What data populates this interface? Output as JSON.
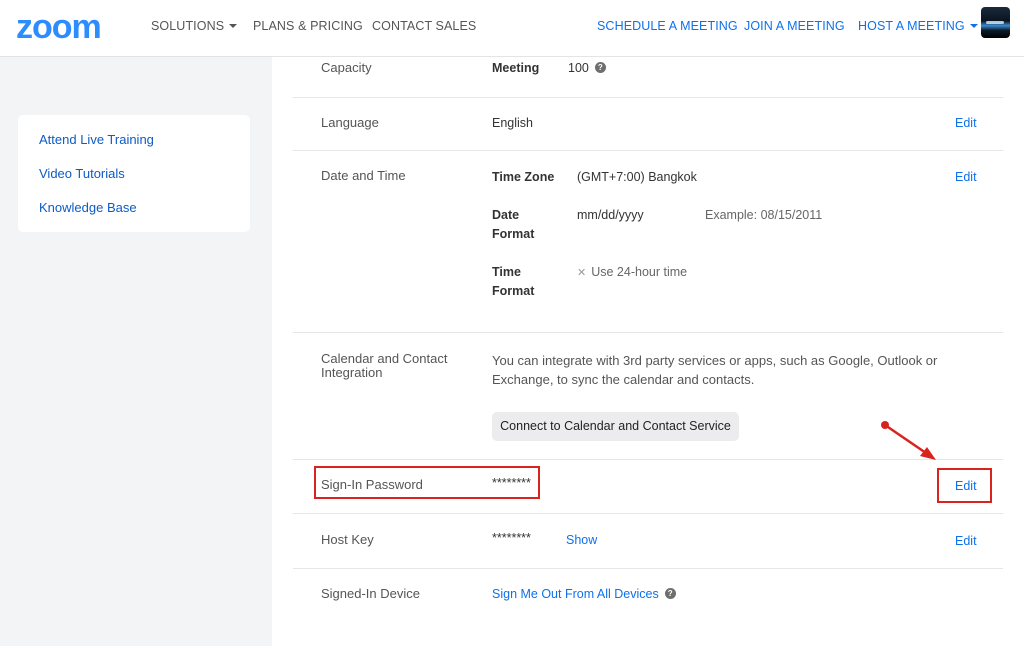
{
  "brand": {
    "logo": "zoom"
  },
  "topnav": {
    "solutions": "SOLUTIONS",
    "plans": "PLANS & PRICING",
    "contact": "CONTACT SALES",
    "schedule": "SCHEDULE A MEETING",
    "join": "JOIN A MEETING",
    "host": "HOST A MEETING"
  },
  "sidebar": {
    "items": [
      {
        "label": "Attend Live Training"
      },
      {
        "label": "Video Tutorials"
      },
      {
        "label": "Knowledge Base"
      }
    ]
  },
  "settings": {
    "capacity": {
      "label": "Capacity",
      "key": "Meeting",
      "value": "100"
    },
    "language": {
      "label": "Language",
      "value": "English",
      "edit": "Edit"
    },
    "datetime": {
      "label": "Date and Time",
      "timezone_key": "Time Zone",
      "timezone_value": "(GMT+7:00) Bangkok",
      "dateformat_key_1": "Date",
      "dateformat_key_2": "Format",
      "dateformat_value": "mm/dd/yyyy",
      "dateformat_example": "Example:  08/15/2011",
      "timeformat_key_1": "Time",
      "timeformat_key_2": "Format",
      "timeformat_value": "Use 24-hour time",
      "edit": "Edit"
    },
    "calendar": {
      "label_1": "Calendar and Contact",
      "label_2": "Integration",
      "description": "You can integrate with 3rd party services or apps, such as Google, Outlook or Exchange, to sync the calendar and contacts.",
      "button": "Connect to Calendar and Contact Service"
    },
    "signin_password": {
      "label": "Sign-In Password",
      "value": "********",
      "edit": "Edit"
    },
    "host_key": {
      "label": "Host Key",
      "value": "********",
      "show": "Show",
      "edit": "Edit"
    },
    "signed_in_device": {
      "label": "Signed-In Device",
      "action": "Sign Me Out From All Devices"
    }
  },
  "colors": {
    "brand_blue": "#2D8CFF",
    "link_blue": "#0E71EB",
    "highlight_red": "#d9231e"
  }
}
